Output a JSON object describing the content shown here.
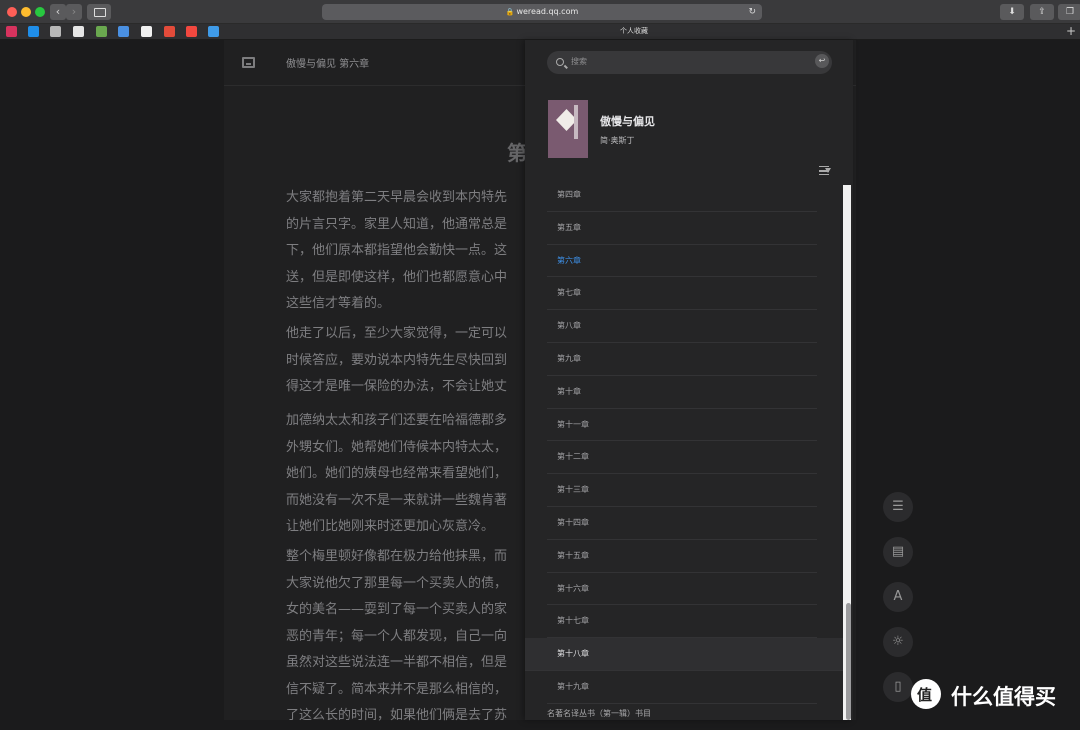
{
  "browser": {
    "url": "weread.qq.com",
    "bookmarks_bar_title": "个人收藏"
  },
  "reader": {
    "header_title": "傲慢与偏见 第六章",
    "chapter_heading": "第",
    "paragraphs": [
      [
        "大家都抱着第二天早晨会收到本内特先",
        "的片言只字。家里人知道，他通常总是",
        "下，他们原本都指望他会勤快一点。这",
        "送，但是即使这样，他们也都愿意心中",
        "这些信才等着的。"
      ],
      [
        "他走了以后，至少大家觉得，一定可以",
        "时候答应，要劝说本内特先生尽快回到",
        "得这才是唯一保险的办法，不会让她丈"
      ],
      [
        "加德纳太太和孩子们还要在哈福德郡多",
        "外甥女们。她帮她们侍候本内特太太，",
        "她们。她们的姨母也经常来看望她们，",
        "而她没有一次不是一来就讲一些魏肯著",
        "让她们比她刚来时还更加心灰意冷。"
      ],
      [
        "整个梅里顿好像都在极力给他抹黑，而",
        "大家说他欠了那里每一个买卖人的债，",
        "女的美名——耍到了每一个买卖人的家",
        "恶的青年；每一个人都发现，自己一向",
        "虽然对这些说法连一半都不相信，但是",
        "信不疑了。简本来并不是那么相信的，",
        "了这么长的时间，如果他们俩是去了苏"
      ]
    ]
  },
  "catalog": {
    "search_placeholder": "搜索",
    "book": {
      "title": "傲慢与偏见",
      "author": "简·奥斯丁"
    },
    "chapters": [
      {
        "label": "第四章",
        "state": "normal"
      },
      {
        "label": "第五章",
        "state": "normal"
      },
      {
        "label": "第六章",
        "state": "active"
      },
      {
        "label": "第七章",
        "state": "normal"
      },
      {
        "label": "第八章",
        "state": "normal"
      },
      {
        "label": "第九章",
        "state": "normal"
      },
      {
        "label": "第十章",
        "state": "normal"
      },
      {
        "label": "第十一章",
        "state": "normal"
      },
      {
        "label": "第十二章",
        "state": "normal"
      },
      {
        "label": "第十三章",
        "state": "normal"
      },
      {
        "label": "第十四章",
        "state": "normal"
      },
      {
        "label": "第十五章",
        "state": "normal"
      },
      {
        "label": "第十六章",
        "state": "normal"
      },
      {
        "label": "第十七章",
        "state": "normal"
      },
      {
        "label": "第十八章",
        "state": "selected"
      },
      {
        "label": "第十九章",
        "state": "normal"
      }
    ],
    "collection_label": "名著名译丛书（第一辑）书目"
  },
  "tools": [
    {
      "name": "list-icon",
      "glyph": "☰"
    },
    {
      "name": "comment-icon",
      "glyph": "▤"
    },
    {
      "name": "font-icon",
      "glyph": "A"
    },
    {
      "name": "brightness-icon",
      "glyph": "☼"
    },
    {
      "name": "phone-icon",
      "glyph": "▯"
    }
  ],
  "watermark": {
    "text": "什么值得买"
  },
  "colors": {
    "accent": "#3d8fe6",
    "panel": "#252526",
    "background": "#1b1b1c"
  }
}
